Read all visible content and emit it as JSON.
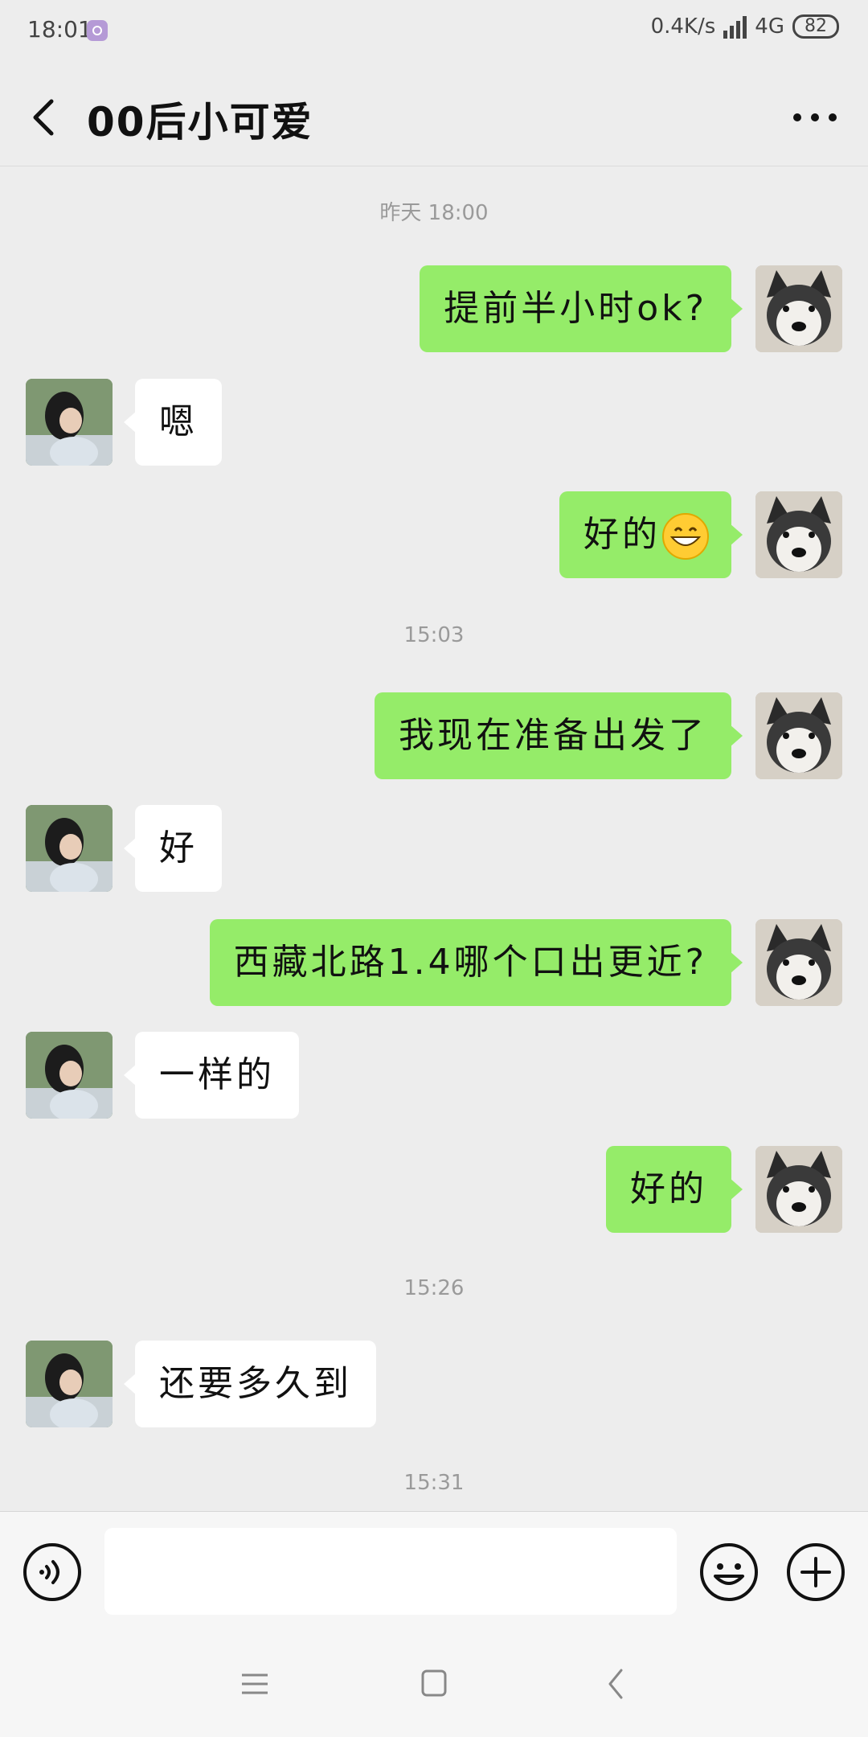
{
  "status_bar": {
    "time": "18:01",
    "network_speed": "0.4K/s",
    "network_type": "4G",
    "battery": "82"
  },
  "header": {
    "back_icon": "chevron-left-icon",
    "title": "00后小可爱",
    "more_icon": "more-dots-icon"
  },
  "chat": {
    "timestamps": [
      "昨天 18:00",
      "15:03",
      "15:26",
      "15:31"
    ],
    "messages": [
      {
        "from": "me",
        "text": "提前半小时ok?"
      },
      {
        "from": "contact",
        "text": "嗯"
      },
      {
        "from": "me",
        "text": "好的",
        "emoji": "grinning-face"
      },
      {
        "from": "me",
        "text": "我现在准备出发了"
      },
      {
        "from": "contact",
        "text": "好"
      },
      {
        "from": "me",
        "text": "西藏北路1.4哪个口出更近?"
      },
      {
        "from": "contact",
        "text": "一样的"
      },
      {
        "from": "me",
        "text": "好的"
      },
      {
        "from": "contact",
        "text": "还要多久到"
      }
    ],
    "bubble_colors": {
      "me": "#95ec69",
      "contact": "#ffffff"
    },
    "avatars": {
      "me": "husky-dog-avatar",
      "contact": "girl-photo-avatar"
    }
  },
  "input_bar": {
    "voice_icon": "voice-icon",
    "input_value": "",
    "emoji_icon": "smiley-icon",
    "plus_icon": "plus-circle-icon"
  },
  "nav_bar": {
    "icons": [
      "menu-icon",
      "home-square-icon",
      "back-chevron-icon"
    ]
  }
}
